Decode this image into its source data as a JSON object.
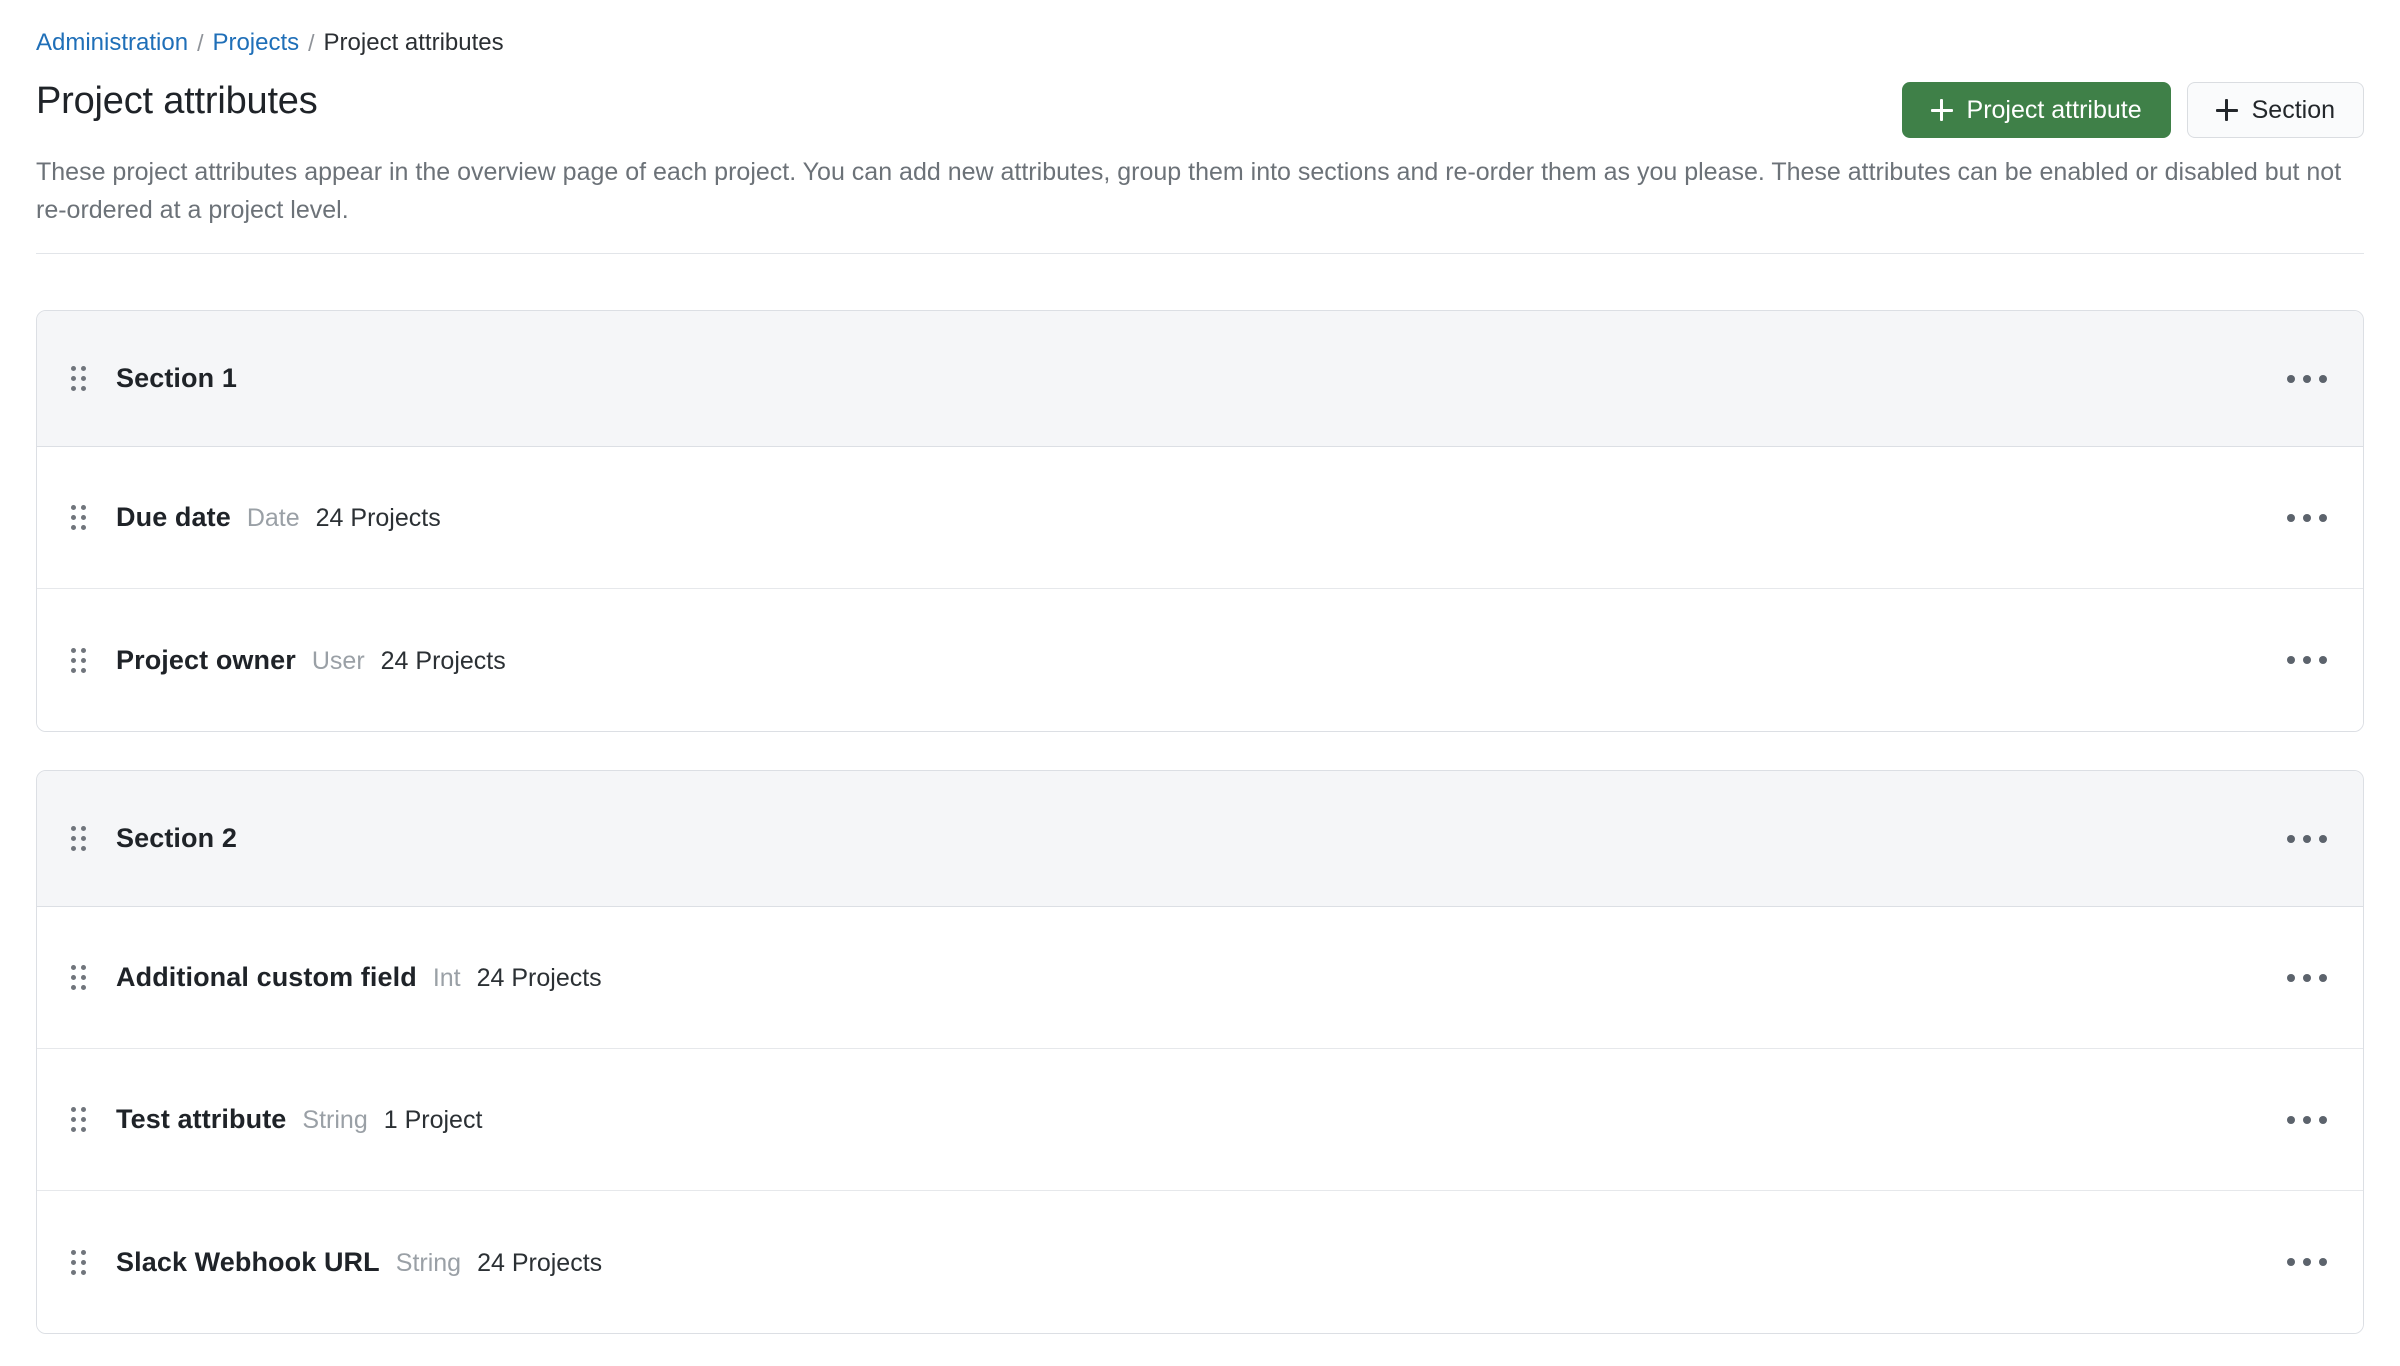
{
  "breadcrumb": {
    "administration": "Administration",
    "projects": "Projects",
    "current": "Project attributes",
    "separator": "/"
  },
  "header": {
    "title": "Project attributes",
    "description": "These project attributes appear in the overview page of each project. You can add new attributes, group them into sections and re-order them as you please. These attributes can be enabled or disabled but not re-ordered at a project level.",
    "primary_button": "Project attribute",
    "secondary_button": "Section",
    "primary_button_color": "#3f8048",
    "plus_icon": "plus-icon"
  },
  "icons": {
    "drag_handle": "drag-handle-icon",
    "kebab_menu": "kebab-menu-icon"
  },
  "sections": [
    {
      "title": "Section 1",
      "attributes": [
        {
          "name": "Due date",
          "type": "Date",
          "count": "24 Projects"
        },
        {
          "name": "Project owner",
          "type": "User",
          "count": "24 Projects"
        }
      ]
    },
    {
      "title": "Section 2",
      "attributes": [
        {
          "name": "Additional custom field",
          "type": "Int",
          "count": "24 Projects"
        },
        {
          "name": "Test attribute",
          "type": "String",
          "count": "1 Project"
        },
        {
          "name": "Slack Webhook URL",
          "type": "String",
          "count": "24 Projects"
        }
      ]
    }
  ]
}
